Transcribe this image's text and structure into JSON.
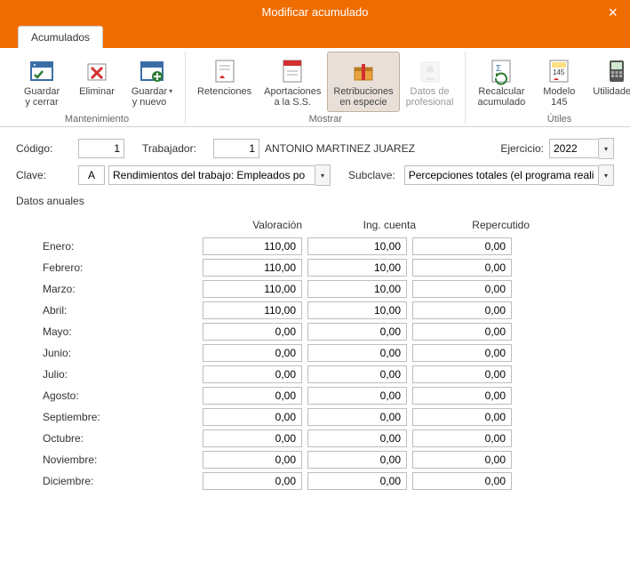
{
  "window": {
    "title": "Modificar acumulado"
  },
  "tabs": {
    "main": "Acumulados"
  },
  "ribbon": {
    "groups": [
      {
        "name": "maintenance",
        "label": "Mantenimiento",
        "buttons": [
          {
            "id": "save-close",
            "label": "Guardar\ny cerrar",
            "dropdown": false
          },
          {
            "id": "delete",
            "label": "Eliminar",
            "dropdown": false
          },
          {
            "id": "save-new",
            "label": "Guardar\ny nuevo",
            "dropdown": true
          }
        ]
      },
      {
        "name": "show",
        "label": "Mostrar",
        "buttons": [
          {
            "id": "withholdings",
            "label": "Retenciones",
            "dropdown": false
          },
          {
            "id": "ss-contrib",
            "label": "Aportaciones\na la S.S.",
            "dropdown": false
          },
          {
            "id": "in-kind",
            "label": "Retribuciones\nen especie",
            "dropdown": false,
            "active": true
          },
          {
            "id": "prof-data",
            "label": "Datos de\nprofesional",
            "dropdown": false,
            "disabled": true
          }
        ]
      },
      {
        "name": "utils",
        "label": "Útiles",
        "buttons": [
          {
            "id": "recalc",
            "label": "Recalcular\nacumulado",
            "dropdown": false
          },
          {
            "id": "model145",
            "label": "Modelo\n145",
            "dropdown": false
          },
          {
            "id": "utilities",
            "label": "Utilidades",
            "dropdown": true
          }
        ]
      }
    ]
  },
  "form": {
    "codigo_label": "Código:",
    "codigo_value": "1",
    "trabajador_label": "Trabajador:",
    "trabajador_value": "1",
    "trabajador_name": "ANTONIO MARTINEZ JUAREZ",
    "ejercicio_label": "Ejercicio:",
    "ejercicio_value": "2022",
    "clave_label": "Clave:",
    "clave_code": "A",
    "clave_text": "Rendimientos del trabajo: Empleados po",
    "subclave_label": "Subclave:",
    "subclave_text": "Percepciones totales (el programa realizará"
  },
  "grid": {
    "section_title": "Datos anuales",
    "headers": {
      "valoracion": "Valoración",
      "ingcuenta": "Ing. cuenta",
      "repercutido": "Repercutido"
    },
    "rows": [
      {
        "month": "Enero:",
        "valoracion": "110,00",
        "ingcuenta": "10,00",
        "repercutido": "0,00"
      },
      {
        "month": "Febrero:",
        "valoracion": "110,00",
        "ingcuenta": "10,00",
        "repercutido": "0,00"
      },
      {
        "month": "Marzo:",
        "valoracion": "110,00",
        "ingcuenta": "10,00",
        "repercutido": "0,00"
      },
      {
        "month": "Abril:",
        "valoracion": "110,00",
        "ingcuenta": "10,00",
        "repercutido": "0,00"
      },
      {
        "month": "Mayo:",
        "valoracion": "0,00",
        "ingcuenta": "0,00",
        "repercutido": "0,00"
      },
      {
        "month": "Junio:",
        "valoracion": "0,00",
        "ingcuenta": "0,00",
        "repercutido": "0,00"
      },
      {
        "month": "Julio:",
        "valoracion": "0,00",
        "ingcuenta": "0,00",
        "repercutido": "0,00"
      },
      {
        "month": "Agosto:",
        "valoracion": "0,00",
        "ingcuenta": "0,00",
        "repercutido": "0,00"
      },
      {
        "month": "Septiembre:",
        "valoracion": "0,00",
        "ingcuenta": "0,00",
        "repercutido": "0,00"
      },
      {
        "month": "Octubre:",
        "valoracion": "0,00",
        "ingcuenta": "0,00",
        "repercutido": "0,00"
      },
      {
        "month": "Noviembre:",
        "valoracion": "0,00",
        "ingcuenta": "0,00",
        "repercutido": "0,00"
      },
      {
        "month": "Diciembre:",
        "valoracion": "0,00",
        "ingcuenta": "0,00",
        "repercutido": "0,00"
      }
    ]
  }
}
